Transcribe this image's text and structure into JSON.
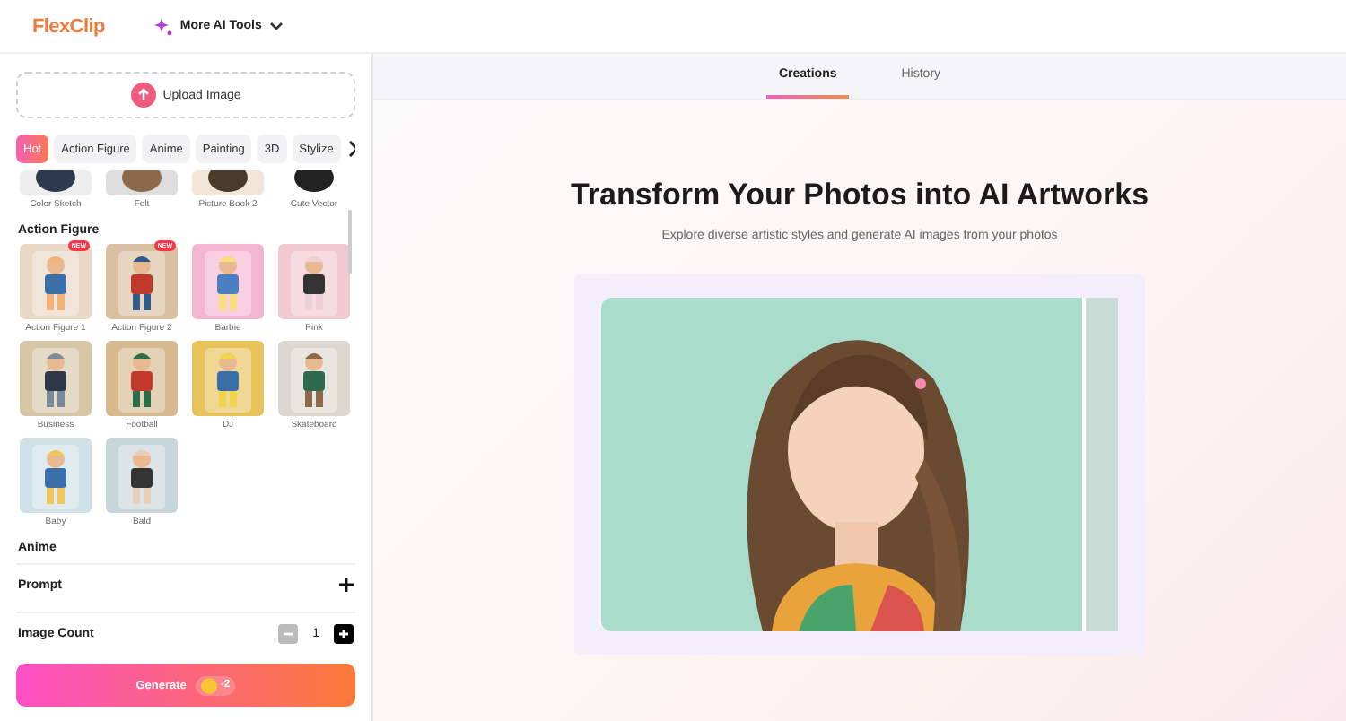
{
  "header": {
    "logo": "FlexClip",
    "menu": "More AI Tools"
  },
  "sidebar": {
    "upload": "Upload Image",
    "categories": [
      {
        "label": "Hot",
        "selected": true
      },
      {
        "label": "Action Figure",
        "selected": false
      },
      {
        "label": "Anime",
        "selected": false
      },
      {
        "label": "Painting",
        "selected": false
      },
      {
        "label": "3D",
        "selected": false
      },
      {
        "label": "Stylize",
        "selected": false
      }
    ],
    "top_items": [
      {
        "label": "Color Sketch"
      },
      {
        "label": "Felt"
      },
      {
        "label": "Picture Book 2"
      },
      {
        "label": "Cute Vector"
      }
    ],
    "sections": [
      {
        "title": "Action Figure",
        "items": [
          {
            "label": "Action Figure 1",
            "badge": "NEW"
          },
          {
            "label": "Action Figure 2",
            "badge": "NEW"
          },
          {
            "label": "Barbie"
          },
          {
            "label": "Pink"
          },
          {
            "label": "Business"
          },
          {
            "label": "Football"
          },
          {
            "label": "DJ"
          },
          {
            "label": "Skateboard"
          },
          {
            "label": "Baby"
          },
          {
            "label": "Bald"
          }
        ]
      },
      {
        "title": "Anime"
      }
    ],
    "prompt": "Prompt",
    "image_count": {
      "label": "Image Count",
      "value": "1"
    },
    "generate": {
      "label": "Generate",
      "cost": "-2"
    }
  },
  "tabs": [
    {
      "label": "Creations",
      "selected": true
    },
    {
      "label": "History",
      "selected": false
    }
  ],
  "hero": {
    "title": "Transform Your Photos into AI Artworks",
    "subtitle": "Explore diverse artistic styles and generate AI images from your photos"
  }
}
